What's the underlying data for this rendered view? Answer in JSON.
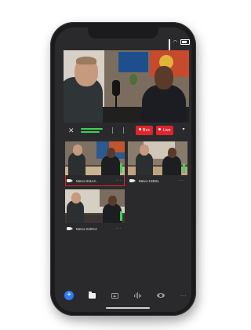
{
  "status_bar": {
    "wifi_icon": "wifi-icon",
    "signal_icon": "signal-icon",
    "battery_icon": "battery-icon"
  },
  "main_preview": {
    "image_description_icon": "live-preview"
  },
  "controls": {
    "mute_icon": "mic-mute-icon",
    "rec_label": "Rec",
    "live_label": "Live",
    "more_icon": "chevron-down-icon",
    "rec_color": "#e0242b",
    "live_color": "#e0242b",
    "meter_color": "#3bd35a"
  },
  "sources": [
    {
      "name": "Mevo-311AA",
      "selected": true,
      "more": "···"
    },
    {
      "name": "Mevo-12BXL",
      "selected": false,
      "more": "···"
    },
    {
      "name": "Mevo-21DCA",
      "selected": false,
      "more": "···"
    }
  ],
  "nav": {
    "items": [
      "plus-icon",
      "folder-icon",
      "image-icon",
      "audio-wave-icon",
      "eye-icon",
      "more-icon"
    ],
    "more_label": "···",
    "accent": "#2e7bf6"
  }
}
